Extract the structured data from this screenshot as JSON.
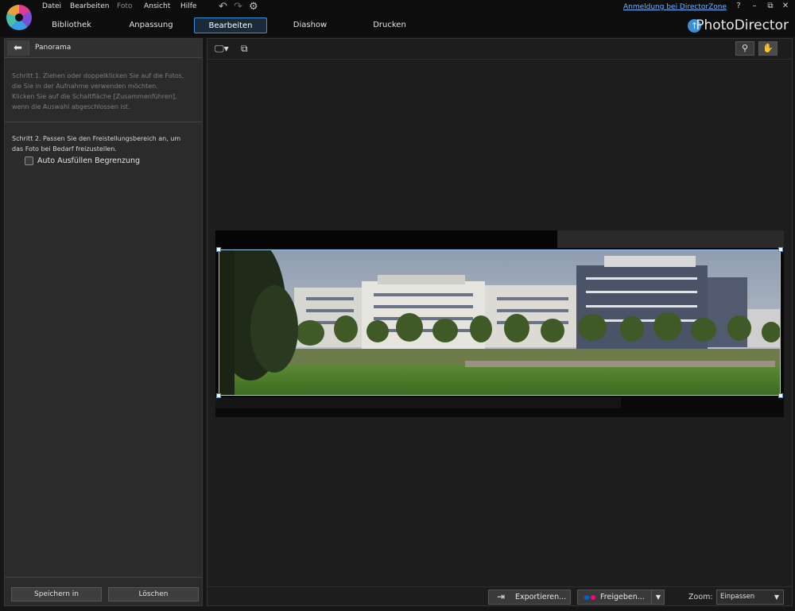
{
  "menu": {
    "items": [
      {
        "label": "Datei",
        "enabled": true
      },
      {
        "label": "Bearbeiten",
        "enabled": true
      },
      {
        "label": "Foto",
        "enabled": false
      },
      {
        "label": "Ansicht",
        "enabled": true
      },
      {
        "label": "Hilfe",
        "enabled": true
      }
    ],
    "login_link": "Anmeldung bei DirectorZone",
    "help_glyph": "?",
    "minimize_glyph": "–",
    "restore_glyph": "⧉",
    "close_glyph": "✕"
  },
  "toolbar_icons": {
    "undo": "undo-icon",
    "redo": "redo-icon",
    "settings": "gear-icon"
  },
  "tabs": [
    {
      "label": "Bibliothek",
      "active": false
    },
    {
      "label": "Anpassung",
      "active": false
    },
    {
      "label": "Bearbeiten",
      "active": true
    },
    {
      "label": "Diashow",
      "active": false
    },
    {
      "label": "Drucken",
      "active": false
    }
  ],
  "brand": {
    "name": "PhotoDirector",
    "icon": "upload-icon"
  },
  "panel": {
    "title": "Panorama",
    "step1": "Schritt 1. Ziehen oder doppelklicken Sie auf die Fotos,\ndie Sie in der Aufnahme verwenden möchten.\nKlicken Sie auf die Schaltfläche [Zusammenführen],\nwenn die Auswahl abgeschlossen ist.",
    "step2": "Schritt 2. Passen Sie den Freistellungsbereich an, um\ndas Foto bei Bedarf freizustellen.",
    "autofill_label": "Auto Ausfüllen Begrenzung",
    "autofill_checked": false,
    "save_button": "Speichern in",
    "delete_button": "Löschen"
  },
  "bottom": {
    "export_button": "Exportieren...",
    "share_button": "Freigeben...",
    "zoom_label": "Zoom:",
    "zoom_value": "Einpassen"
  },
  "colors": {
    "accent": "#3d8fd9",
    "link": "#6fb6ff",
    "flickr_blue": "#0063dc",
    "flickr_pink": "#ff0084"
  }
}
